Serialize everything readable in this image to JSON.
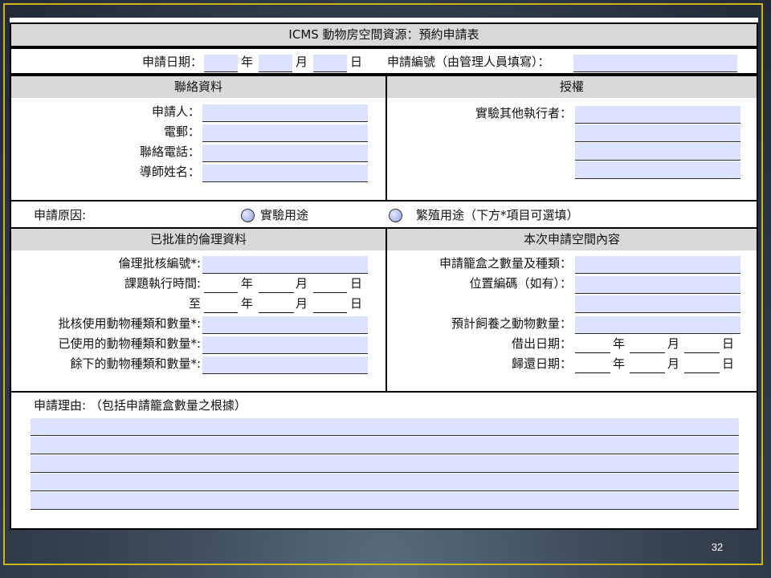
{
  "page_number": "32",
  "title": "ICMS 動物房空間資源：預約申請表",
  "row1": {
    "date_label": "申請日期：",
    "year": "年",
    "month": "月",
    "day": "日",
    "app_no_label": "申請編號（由管理人員填寫）："
  },
  "contact": {
    "header": "聯絡資料",
    "applicant": "申請人：",
    "email": "電郵：",
    "phone": "聯絡電話：",
    "supervisor": "導師姓名："
  },
  "auth": {
    "header": "授權",
    "other_executors": "實驗其他執行者："
  },
  "reason": {
    "label": "申請原因:",
    "option1": "實驗用途",
    "option2": "繁殖用途（下方*項目可選填）"
  },
  "ethics": {
    "header": "已批准的倫理資料",
    "approval_no": "倫理批核編號*:",
    "period": "課題執行時間:",
    "to": "至",
    "year": "年",
    "month": "月",
    "day": "日",
    "approved_animals": "批核使用動物種類和數量*:",
    "used_animals": "已使用的動物種類和數量*:",
    "remaining_animals": "餘下的動物種類和數量*:"
  },
  "space": {
    "header": "本次申請空間內容",
    "cage_qty": "申請籠盒之數量及種類：",
    "location": "位置編碼（如有）：",
    "animal_count": "預計飼養之動物數量：",
    "borrow_date": "借出日期：",
    "return_date": "歸還日期：",
    "year": "年",
    "month": "月",
    "day": "日"
  },
  "justification": {
    "label": "申請理由: （包括申請籠盒數量之根據）"
  }
}
